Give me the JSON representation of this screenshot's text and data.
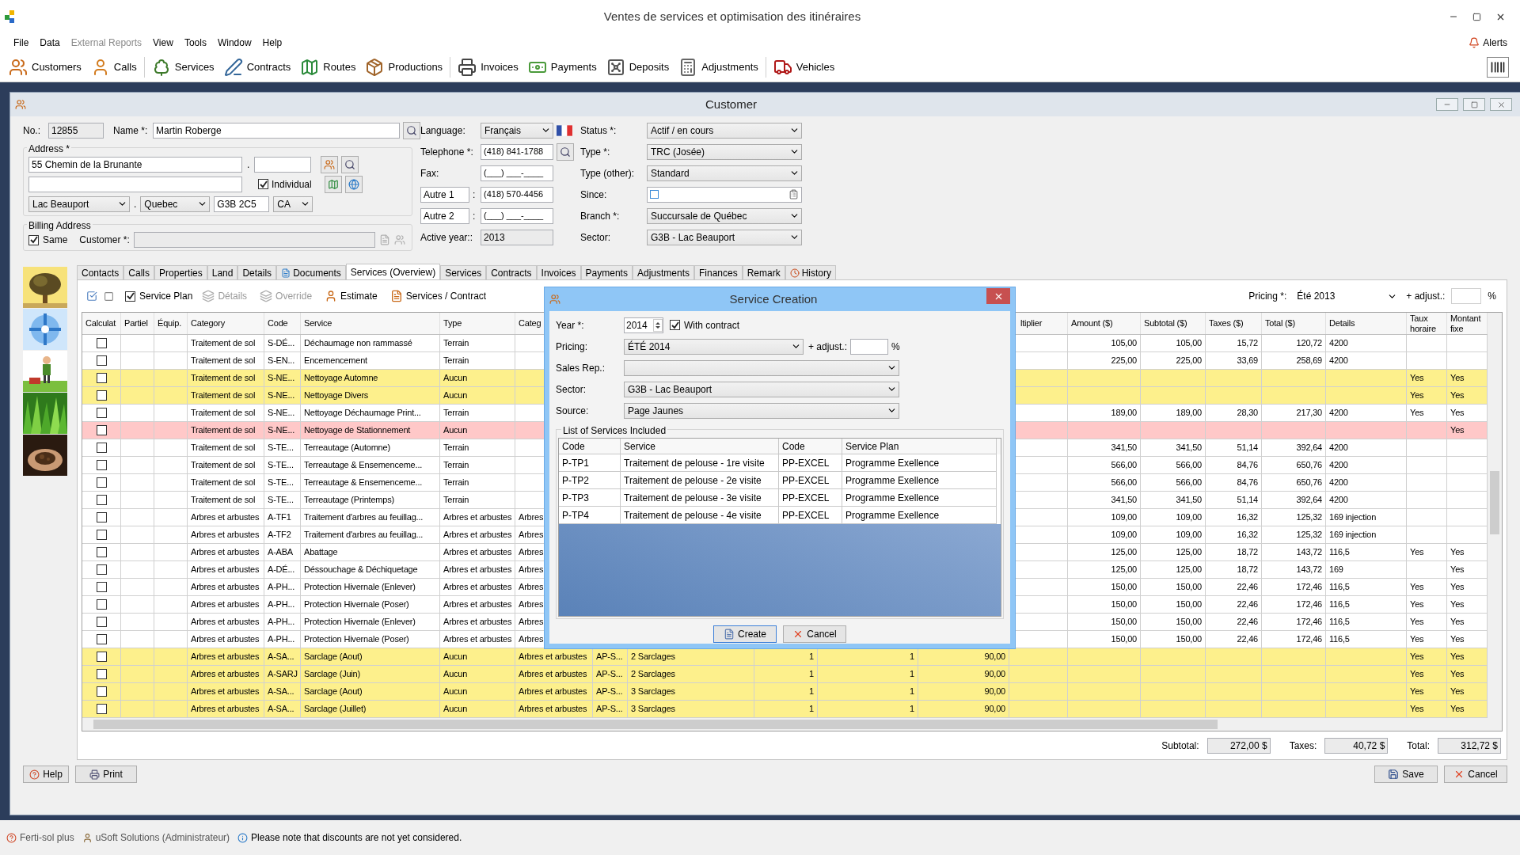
{
  "app": {
    "title": "Ventes de services et optimisation des itinéraires"
  },
  "menu": [
    {
      "label": "File",
      "disabled": false
    },
    {
      "label": "Data",
      "disabled": false
    },
    {
      "label": "External Reports",
      "disabled": true
    },
    {
      "label": "View",
      "disabled": false
    },
    {
      "label": "Tools",
      "disabled": false
    },
    {
      "label": "Window",
      "disabled": false
    },
    {
      "label": "Help",
      "disabled": false
    }
  ],
  "alerts": "Alerts",
  "toolbar": [
    "Customers",
    "Calls",
    "Services",
    "Contracts",
    "Routes",
    "Productions",
    "Invoices",
    "Payments",
    "Deposits",
    "Adjustments",
    "Vehicles"
  ],
  "customer": {
    "title": "Customer",
    "no": {
      "label": "No.:",
      "value": "12855"
    },
    "name": {
      "label": "Name *:",
      "value": "Martin Roberge"
    },
    "address": {
      "legend": "Address *",
      "line1": "55 Chemin de la Brunante",
      "dot_1": ".",
      "individual": {
        "label": "Individual",
        "checked": true
      },
      "city": "Lac Beauport",
      "dot_2": ".",
      "province": "Quebec",
      "postal": "G3B 2C5",
      "country": "CA"
    },
    "billing": {
      "legend": "Billing Address",
      "same": {
        "label": "Same",
        "checked": true
      },
      "customer_label": "Customer *:"
    },
    "language": {
      "label": "Language:",
      "value": "Français"
    },
    "telephone": {
      "label": "Telephone *:",
      "value": "(418) 841-1788"
    },
    "fax": {
      "label": "Fax:",
      "value": "(___) ___-____"
    },
    "other_1": {
      "label": "Autre 1",
      "separator": ":",
      "value": "(418) 570-4456"
    },
    "other_2": {
      "label": "Autre 2",
      "separator": ":",
      "value": "(___) ___-____"
    },
    "active_year": {
      "label": "Active year::",
      "value": "2013"
    },
    "status": {
      "label": "Status *:",
      "value": "Actif / en cours"
    },
    "type": {
      "label": "Type *:",
      "value": "TRC (Josée)"
    },
    "type_other": {
      "label": "Type (other):",
      "value": "Standard"
    },
    "since": {
      "label": "Since:",
      "checked": false
    },
    "branch": {
      "label": "Branch *:",
      "value": "Succursale de Québec"
    },
    "sector": {
      "label": "Sector:",
      "value": "G3B - Lac Beauport"
    }
  },
  "tabs": [
    {
      "label": "Contacts",
      "selected": false
    },
    {
      "label": "Calls",
      "selected": false
    },
    {
      "label": "Properties",
      "selected": false
    },
    {
      "label": "Land",
      "selected": false
    },
    {
      "label": "Details",
      "selected": false
    },
    {
      "label": "Documents",
      "selected": false
    },
    {
      "label": "Services (Overview)",
      "selected": true
    },
    {
      "label": "Services",
      "selected": false
    },
    {
      "label": "Contracts",
      "selected": false
    },
    {
      "label": "Invoices",
      "selected": false
    },
    {
      "label": "Payments",
      "selected": false
    },
    {
      "label": "Adjustments",
      "selected": false
    },
    {
      "label": "Finances",
      "selected": false
    },
    {
      "label": "Remark",
      "selected": false
    },
    {
      "label": "History",
      "selected": false
    }
  ],
  "service_toolbar": {
    "service_plan": {
      "label": "Service Plan",
      "checked": true
    },
    "buttons": [
      {
        "label": "Détails",
        "disabled": true
      },
      {
        "label": "Override",
        "disabled": true
      },
      {
        "label": "Estimate",
        "disabled": false
      },
      {
        "label": "Services / Contract",
        "disabled": false
      }
    ],
    "pricing": {
      "label": "Pricing *:",
      "value": "Été 2013"
    },
    "adjust": {
      "label": "+ adjust.:",
      "unit": "%"
    }
  },
  "table": {
    "header": {
      "calculate": "Calculat",
      "partiel": "Partiel",
      "equip": "Équip.",
      "category": "Category",
      "code": "Code",
      "service": "Service",
      "type": "Type",
      "category_2": "Categ",
      "multiplier": "ltiplier",
      "amount": "Amount ($)",
      "subtotal": "Subtotal ($)",
      "taxes": "Taxes ($)",
      "total": "Total ($)",
      "details": "Details",
      "taux_horaire": "Taux horaire",
      "montant_fixe": "Montant fixe"
    },
    "rows": [
      {
        "color": "#ffffff",
        "checked": false,
        "category": "Traitement de sol",
        "code": "S-DÉ...",
        "service": "Déchaumage non rammassé",
        "type": "Terrain",
        "amount": "105,00",
        "subtotal": "105,00",
        "taxes": "15,72",
        "total": "120,72",
        "details": "4200"
      },
      {
        "color": "#ffffff",
        "checked": false,
        "category": "Traitement de sol",
        "code": "S-EN...",
        "service": "Encemencement",
        "type": "Terrain",
        "amount": "225,00",
        "subtotal": "225,00",
        "taxes": "33,69",
        "total": "258,69",
        "details": "4200"
      },
      {
        "color": "#fdf08c",
        "checked": false,
        "category": "Traitement de sol",
        "code": "S-NE...",
        "service": "Nettoyage Automne",
        "type": "Aucun",
        "taux_horaire": "Yes",
        "montant_fixe": "Yes"
      },
      {
        "color": "#fdf08c",
        "checked": false,
        "category": "Traitement de sol",
        "code": "S-NE...",
        "service": "Nettoyage Divers",
        "type": "Aucun",
        "taux_horaire": "Yes",
        "montant_fixe": "Yes"
      },
      {
        "color": "#ffffff",
        "checked": false,
        "category": "Traitement de sol",
        "code": "S-NE...",
        "service": "Nettoyage Déchaumage Print...",
        "type": "Terrain",
        "amount": "189,00",
        "subtotal": "189,00",
        "taxes": "28,30",
        "total": "217,30",
        "details": "4200",
        "taux_horaire": "Yes",
        "montant_fixe": "Yes"
      },
      {
        "color": "#ffc8c8",
        "checked": false,
        "category": "Traitement de sol",
        "code": "S-NE...",
        "service": "Nettoyage de Stationnement",
        "type": "Aucun",
        "montant_fixe": "Yes"
      },
      {
        "color": "#ffffff",
        "checked": false,
        "category": "Traitement de sol",
        "code": "S-TE...",
        "service": "Terreautage (Automne)",
        "type": "Terrain",
        "amount": "341,50",
        "subtotal": "341,50",
        "taxes": "51,14",
        "total": "392,64",
        "details": "4200"
      },
      {
        "color": "#ffffff",
        "checked": false,
        "category": "Traitement de sol",
        "code": "S-TE...",
        "service": "Terreautage & Ensemenceme...",
        "type": "Terrain",
        "amount": "566,00",
        "subtotal": "566,00",
        "taxes": "84,76",
        "total": "650,76",
        "details": "4200"
      },
      {
        "color": "#ffffff",
        "checked": false,
        "category": "Traitement de sol",
        "code": "S-TE...",
        "service": "Terreautage & Ensemenceme...",
        "type": "Terrain",
        "amount": "566,00",
        "subtotal": "566,00",
        "taxes": "84,76",
        "total": "650,76",
        "details": "4200"
      },
      {
        "color": "#ffffff",
        "checked": false,
        "category": "Traitement de sol",
        "code": "S-TE...",
        "service": "Terreautage (Printemps)",
        "type": "Terrain",
        "amount": "341,50",
        "subtotal": "341,50",
        "taxes": "51,14",
        "total": "392,64",
        "details": "4200"
      },
      {
        "color": "#ffffff",
        "checked": false,
        "category": "Arbres et arbustes",
        "code": "A-TF1",
        "service": "Traitement d'arbres au feuillag...",
        "type": "Arbres et arbustes",
        "category_2": "Arbres",
        "amount": "109,00",
        "subtotal": "109,00",
        "taxes": "16,32",
        "total": "125,32",
        "details": "169 injection"
      },
      {
        "color": "#ffffff",
        "checked": false,
        "category": "Arbres et arbustes",
        "code": "A-TF2",
        "service": "Traitement d'arbres au feuillag...",
        "type": "Arbres et arbustes",
        "category_2": "Arbres",
        "amount": "109,00",
        "subtotal": "109,00",
        "taxes": "16,32",
        "total": "125,32",
        "details": "169 injection"
      },
      {
        "color": "#ffffff",
        "checked": false,
        "category": "Arbres et arbustes",
        "code": "A-ABA",
        "service": "Abattage",
        "type": "Arbres et arbustes",
        "category_2": "Arbres",
        "amount": "125,00",
        "subtotal": "125,00",
        "taxes": "18,72",
        "total": "143,72",
        "details": "116,5",
        "taux_horaire": "Yes",
        "montant_fixe": "Yes"
      },
      {
        "color": "#ffffff",
        "checked": false,
        "category": "Arbres et arbustes",
        "code": "A-DÉ...",
        "service": "Déssouchage & Déchiquetage",
        "type": "Arbres et arbustes",
        "category_2": "Arbres",
        "amount": "125,00",
        "subtotal": "125,00",
        "taxes": "18,72",
        "total": "143,72",
        "details": "169",
        "montant_fixe": "Yes"
      },
      {
        "color": "#ffffff",
        "checked": false,
        "category": "Arbres et arbustes",
        "code": "A-PH...",
        "service": "Protection Hivernale (Enlever)",
        "type": "Arbres et arbustes",
        "category_2": "Arbres",
        "amount": "150,00",
        "subtotal": "150,00",
        "taxes": "22,46",
        "total": "172,46",
        "details": "116,5",
        "taux_horaire": "Yes",
        "montant_fixe": "Yes"
      },
      {
        "color": "#ffffff",
        "checked": false,
        "category": "Arbres et arbustes",
        "code": "A-PH...",
        "service": "Protection Hivernale (Poser)",
        "type": "Arbres et arbustes",
        "category_2": "Arbres",
        "amount": "150,00",
        "subtotal": "150,00",
        "taxes": "22,46",
        "total": "172,46",
        "details": "116,5",
        "taux_horaire": "Yes",
        "montant_fixe": "Yes"
      },
      {
        "color": "#ffffff",
        "checked": false,
        "category": "Arbres et arbustes",
        "code": "A-PH...",
        "service": "Protection Hivernale (Enlever)",
        "type": "Arbres et arbustes",
        "category_2": "Arbres",
        "amount": "150,00",
        "subtotal": "150,00",
        "taxes": "22,46",
        "total": "172,46",
        "details": "116,5",
        "taux_horaire": "Yes",
        "montant_fixe": "Yes"
      },
      {
        "color": "#ffffff",
        "checked": false,
        "category": "Arbres et arbustes",
        "code": "A-PH...",
        "service": "Protection Hivernale (Poser)",
        "type": "Arbres et arbustes",
        "category_2": "Arbres",
        "amount": "150,00",
        "subtotal": "150,00",
        "taxes": "22,46",
        "total": "172,46",
        "details": "116,5",
        "taux_horaire": "Yes",
        "montant_fixe": "Yes"
      },
      {
        "color": "#fdf08c",
        "checked": false,
        "category": "Arbres et arbustes",
        "code": "A-SA...",
        "service": "Sarclage (Aout)",
        "type": "Aucun",
        "category_2": "Arbres et arbustes",
        "column_9": "AP-S...",
        "column_10": "2 Sarclages",
        "column_11": "1",
        "column_12": "1",
        "column_13": "90,00",
        "taux_horaire": "Yes",
        "montant_fixe": "Yes"
      },
      {
        "color": "#fdf08c",
        "checked": false,
        "category": "Arbres et arbustes",
        "code": "A-SARJ",
        "service": "Sarclage (Juin)",
        "type": "Aucun",
        "category_2": "Arbres et arbustes",
        "column_9": "AP-S...",
        "column_10": "2 Sarclages",
        "column_11": "1",
        "column_12": "1",
        "column_13": "90,00",
        "taux_horaire": "Yes",
        "montant_fixe": "Yes"
      },
      {
        "color": "#fdf08c",
        "checked": false,
        "category": "Arbres et arbustes",
        "code": "A-SA...",
        "service": "Sarclage (Aout)",
        "type": "Aucun",
        "category_2": "Arbres et arbustes",
        "column_9": "AP-S...",
        "column_10": "3 Sarclages",
        "column_11": "1",
        "column_12": "1",
        "column_13": "90,00",
        "taux_horaire": "Yes",
        "montant_fixe": "Yes"
      },
      {
        "color": "#fdf08c",
        "checked": false,
        "category": "Arbres et arbustes",
        "code": "A-SA...",
        "service": "Sarclage (Juillet)",
        "type": "Aucun",
        "category_2": "Arbres et arbustes",
        "column_9": "AP-S...",
        "column_10": "3 Sarclages",
        "column_11": "1",
        "column_12": "1",
        "column_13": "90,00",
        "taux_horaire": "Yes",
        "montant_fixe": "Yes"
      }
    ]
  },
  "totals": [
    {
      "label": "Subtotal:",
      "value": "272,00 $"
    },
    {
      "label": "Taxes:",
      "value": "40,72 $"
    },
    {
      "label": "Total:",
      "value": "312,72 $"
    }
  ],
  "footer_buttons": {
    "left": [
      "Help",
      "Print"
    ],
    "right": [
      "Save",
      "Cancel"
    ]
  },
  "dialog": {
    "title": "Service Creation",
    "year": {
      "label": "Year *:",
      "value": "2014"
    },
    "with_contract": {
      "label": "With contract",
      "checked": true
    },
    "pricing": {
      "label": "Pricing:",
      "value": "ÉTÉ 2014"
    },
    "adjust": {
      "label": "+ adjust.:",
      "unit": "%"
    },
    "sales_rep": {
      "label": "Sales Rep.:"
    },
    "sector": {
      "label": "Sector:",
      "value": "G3B - Lac Beauport"
    },
    "source": {
      "label": "Source:",
      "value": "Page Jaunes"
    },
    "list": {
      "legend": "List of Services Included",
      "columns": [
        "Code",
        "Service",
        "Code",
        "Service Plan"
      ],
      "rows": [
        [
          "P-TP1",
          "Traitement de pelouse - 1re visite",
          "PP-EXCEL",
          "Programme Exellence"
        ],
        [
          "P-TP2",
          "Traitement de pelouse - 2e visite",
          "PP-EXCEL",
          "Programme Exellence"
        ],
        [
          "P-TP3",
          "Traitement de pelouse - 3e visite",
          "PP-EXCEL",
          "Programme Exellence"
        ],
        [
          "P-TP4",
          "Traitement de pelouse - 4e visite",
          "PP-EXCEL",
          "Programme Exellence"
        ]
      ]
    },
    "buttons": [
      "Create",
      "Cancel"
    ]
  },
  "status_bar": [
    "Ferti-sol plus",
    "uSoft Solutions (Administrateur)",
    "Please note that discounts are not yet considered."
  ]
}
